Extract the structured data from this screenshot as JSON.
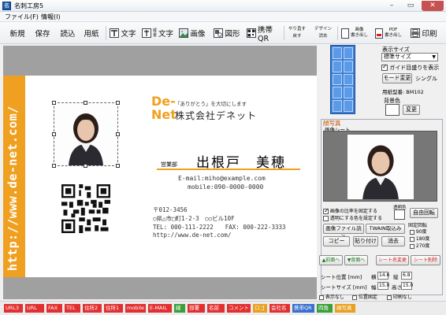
{
  "window": {
    "title": "名刺工房5",
    "app_icon_glyph": "名"
  },
  "menu": {
    "file": "ファイル(F)",
    "info": "情報(I)"
  },
  "toolbar": {
    "new": "新規",
    "save": "保存",
    "read": "読込",
    "paper": "用紙",
    "text": "文字",
    "vtext_top": "縦",
    "vtext_bottom": "書",
    "vertical_text": "文字",
    "image": "画像",
    "shape": "図形",
    "barcode": "携帯QR",
    "undo_top": "やり直す",
    "undo_bottom": "戻す",
    "design_top": "デザイン",
    "design_bottom": "消去",
    "imgout_top": "画像",
    "imgout_bottom": "書き出し",
    "pdf_top": "PDF",
    "pdf_bottom": "書き出し",
    "print": "印刷"
  },
  "card": {
    "url_vertical": "http://www.de-net.com/",
    "logo_de": "De-",
    "logo_net": "Net",
    "tagline": "「ありがとう」を大切にします",
    "company": "株式会社デネット",
    "department": "営業部",
    "name": "出根戸　美穂",
    "email": "E-mail:miho@example.com",
    "mobile": "mobile:090-0000-0000",
    "postal": "〒012-3456",
    "address": "○県△市□町1-2-3　○○ビル10F",
    "tel_fax": "TEL: 000-111-2222　　FAX: 000-222-3333",
    "url": "http://www.de-net.com/"
  },
  "panel": {
    "display_size_label": "表示サイズ",
    "display_size_value": "標準サイズ",
    "guide_label": "ガイド目盛りを表示",
    "mode_button": "モード変更",
    "mode_value": "シングル",
    "paper_label": "用紙型番: BM102",
    "bg_color_label": "背景色",
    "change_button": "変更",
    "photo_section_title": "顔写真",
    "sheet_label": "画像シート",
    "fix_ratio_label": "画像の比率を固定する",
    "transparent_label": "透明にする色を設定する",
    "transparent_color_label": "透明色",
    "free_rotate_button": "自由回転",
    "load_image_button": "画像ファイル読込",
    "twain_button": "TWAIN取込み",
    "copy_button": "コピー",
    "paste_button": "貼り付け",
    "delete_button": "消去",
    "rotate_title": "固定回転",
    "rotate_90": "90度",
    "rotate_180": "180度",
    "rotate_270": "270度",
    "front_button": "▲前面へ",
    "back_button": "▼背面へ",
    "sheet_change_button": "シート名変更",
    "sheet_delete_button": "シート削除",
    "pos_label": "シート位置 [mm]",
    "horiz_label": "横",
    "horiz_value": "14.6",
    "vert_label": "縦",
    "vert_value": "6.8",
    "size_label": "シートサイズ [mm]",
    "width_label": "幅",
    "width_value": "15.0",
    "height_label": "高さ",
    "height_value": "15.0",
    "hide_label": "表示なし",
    "fixed_pos_label": "位置固定",
    "no_print_label": "印刷なし"
  },
  "tags": [
    {
      "label": "URL3",
      "color": "#e23030"
    },
    {
      "label": "URL",
      "color": "#e23030"
    },
    {
      "label": "FAX",
      "color": "#e23030"
    },
    {
      "label": "TEL",
      "color": "#e23030"
    },
    {
      "label": "住所2",
      "color": "#e23030"
    },
    {
      "label": "住所1",
      "color": "#e23030"
    },
    {
      "label": "mobile",
      "color": "#e23030"
    },
    {
      "label": "E-MAIL",
      "color": "#e23030"
    },
    {
      "label": "線",
      "color": "#3aa03a"
    },
    {
      "label": "部署",
      "color": "#e23030"
    },
    {
      "label": "名前",
      "color": "#e23030"
    },
    {
      "label": "コメント",
      "color": "#e23030"
    },
    {
      "label": "ロゴ",
      "color": "#e8a020"
    },
    {
      "label": "会社名",
      "color": "#e23030"
    },
    {
      "label": "携帯QR",
      "color": "#3a6fd0"
    },
    {
      "label": "四角",
      "color": "#3aa03a"
    },
    {
      "label": "顔写真",
      "color": "#e8a020"
    }
  ],
  "colors": {
    "accent": "#f0a020",
    "canvas_bg": "#a0a0a0",
    "selection": "#3d7fd6"
  }
}
